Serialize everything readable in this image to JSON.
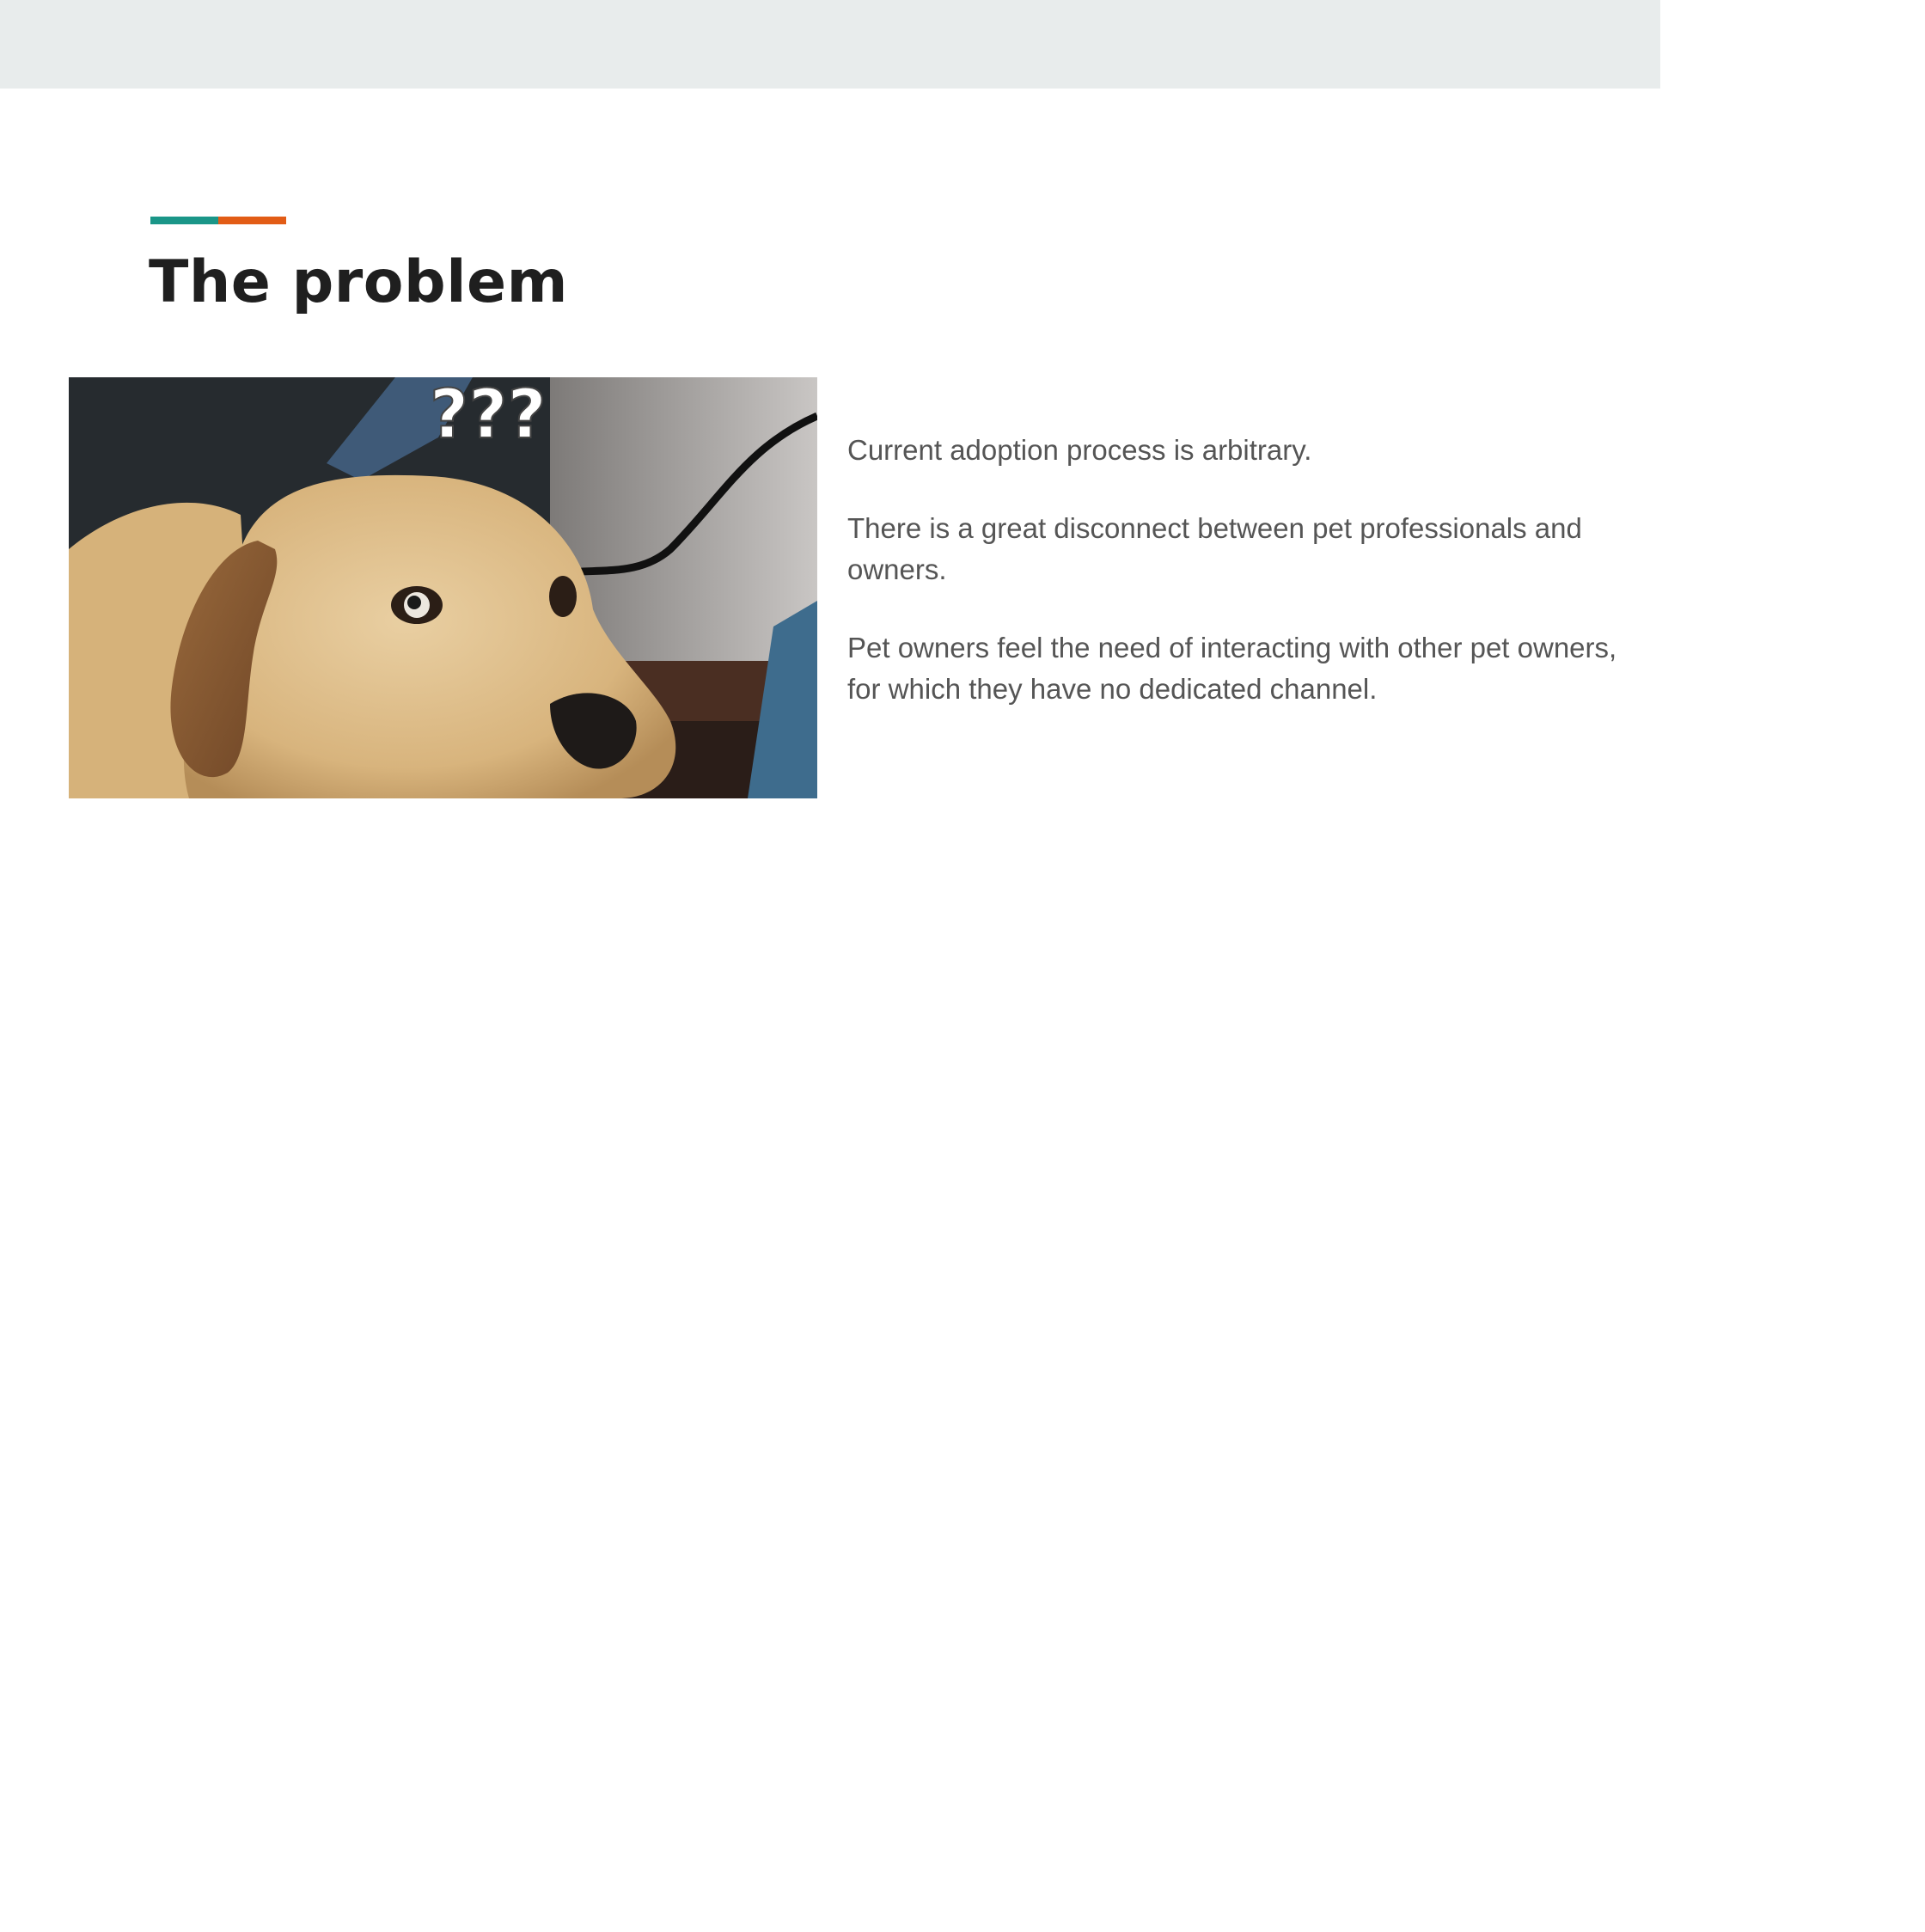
{
  "colors": {
    "topbar": "#e8ecec",
    "accent_teal": "#1a9688",
    "accent_orange": "#e25c16",
    "heading": "#1f1f1f",
    "body_text": "#555555"
  },
  "section": {
    "title": "The problem",
    "image": {
      "icon": "confused-dog-photo",
      "overlay_text": "???"
    },
    "paragraphs": [
      "Current adoption process is arbitrary.",
      "There is a great disconnect between pet professionals and owners.",
      "Pet owners feel the need of interacting with other pet owners, for which they have no dedicated channel."
    ]
  }
}
